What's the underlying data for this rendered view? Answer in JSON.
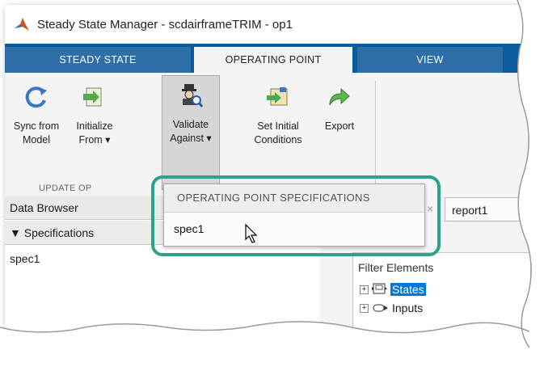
{
  "window": {
    "title": "Steady State Manager - scdairframeTRIM - op1"
  },
  "tabs": [
    {
      "label": "STEADY STATE",
      "active": false
    },
    {
      "label": "OPERATING POINT",
      "active": true
    },
    {
      "label": "VIEW",
      "active": false
    }
  ],
  "ribbon": {
    "sync_label_1": "Sync from",
    "sync_label_2": "Model",
    "init_label_1": "Initialize",
    "init_label_2": "From ▾",
    "validate_label_1": "Validate",
    "validate_label_2": "Against ▾",
    "setic_label_1": "Set Initial",
    "setic_label_2": "Conditions",
    "export_label": "Export",
    "group_label": "UPDATE OP"
  },
  "data_browser": {
    "title": "Data Browser",
    "section": "▼ Specifications",
    "items": [
      "spec1"
    ]
  },
  "report": {
    "tab_label": "report1",
    "close": "×",
    "filter_label": "Filter Elements",
    "tree": [
      {
        "label": "States",
        "selected": true
      },
      {
        "label": "Inputs",
        "selected": false
      }
    ]
  },
  "popup": {
    "header": "OPERATING POINT SPECIFICATIONS",
    "items": [
      "spec1"
    ]
  },
  "colors": {
    "tabstrip": "#0b5c9e",
    "highlight_ring": "#2aa389",
    "selection": "#0078d7"
  }
}
